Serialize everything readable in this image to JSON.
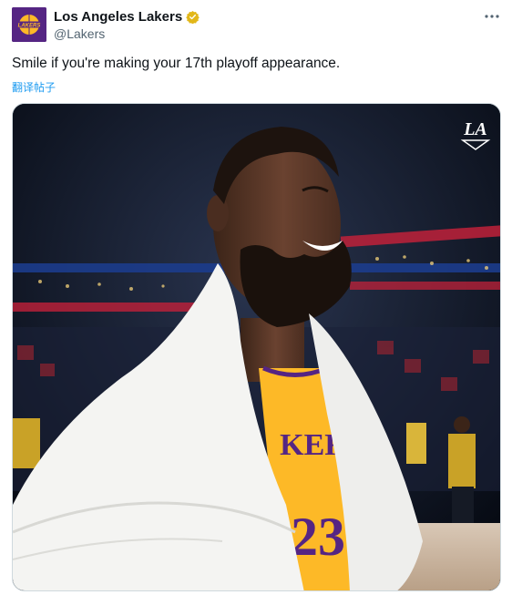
{
  "author": {
    "display_name": "Los Angeles Lakers",
    "handle": "@Lakers",
    "avatar_logo_text": "LAKERS"
  },
  "tweet": {
    "text": "Smile if you're making your 17th playoff appearance.",
    "translate_label": "翻译帖子"
  },
  "media": {
    "watermark_text": "LA",
    "jersey_text": "KER",
    "jersey_number": "23"
  },
  "icons": {
    "verified": "verified-badge-icon",
    "more": "more-options-icon"
  },
  "colors": {
    "lakers_purple": "#552583",
    "lakers_gold": "#fdb927",
    "link_blue": "#1d9bf0",
    "verified_gold": "#e2b719"
  }
}
